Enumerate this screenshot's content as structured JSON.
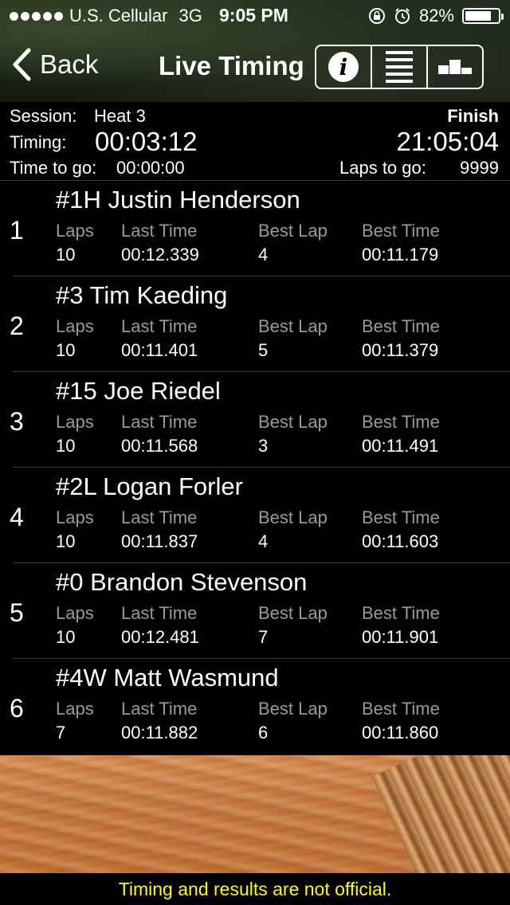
{
  "status_bar": {
    "carrier": "U.S. Cellular",
    "network": "3G",
    "time": "9:05 PM",
    "battery_percent": "82%",
    "battery_level": 0.82,
    "signal_dots": 5
  },
  "nav": {
    "back_label": "Back",
    "title": "Live Timing",
    "info_glyph": "i",
    "segments": [
      "info-icon",
      "list-icon",
      "podium-icon"
    ]
  },
  "session": {
    "session_label": "Session:",
    "session_value": "Heat 3",
    "timing_label": "Timing:",
    "timing_value": "00:03:12",
    "time_to_go_label": "Time to go:",
    "time_to_go_value": "00:00:00",
    "finish_label": "Finish",
    "finish_value": "21:05:04",
    "laps_to_go_label": "Laps to go:",
    "laps_to_go_value": "9999"
  },
  "columns": {
    "laps": "Laps",
    "last_time": "Last Time",
    "best_lap": "Best Lap",
    "best_time": "Best Time"
  },
  "rows": [
    {
      "pos": "1",
      "name": "#1H Justin Henderson",
      "laps": "10",
      "last_time": "00:12.339",
      "best_lap": "4",
      "best_time": "00:11.179"
    },
    {
      "pos": "2",
      "name": "#3 Tim Kaeding",
      "laps": "10",
      "last_time": "00:11.401",
      "best_lap": "5",
      "best_time": "00:11.379"
    },
    {
      "pos": "3",
      "name": "#15 Joe Riedel",
      "laps": "10",
      "last_time": "00:11.568",
      "best_lap": "3",
      "best_time": "00:11.491"
    },
    {
      "pos": "4",
      "name": "#2L Logan Forler",
      "laps": "10",
      "last_time": "00:11.837",
      "best_lap": "4",
      "best_time": "00:11.603"
    },
    {
      "pos": "5",
      "name": "#0 Brandon Stevenson",
      "laps": "10",
      "last_time": "00:12.481",
      "best_lap": "7",
      "best_time": "00:11.901"
    },
    {
      "pos": "6",
      "name": "#4W Matt Wasmund",
      "laps": "7",
      "last_time": "00:11.882",
      "best_lap": "6",
      "best_time": "00:11.860"
    }
  ],
  "footer": {
    "disclaimer": "Timing and results are not official.",
    "disclaimer_color": "#ffff00"
  }
}
